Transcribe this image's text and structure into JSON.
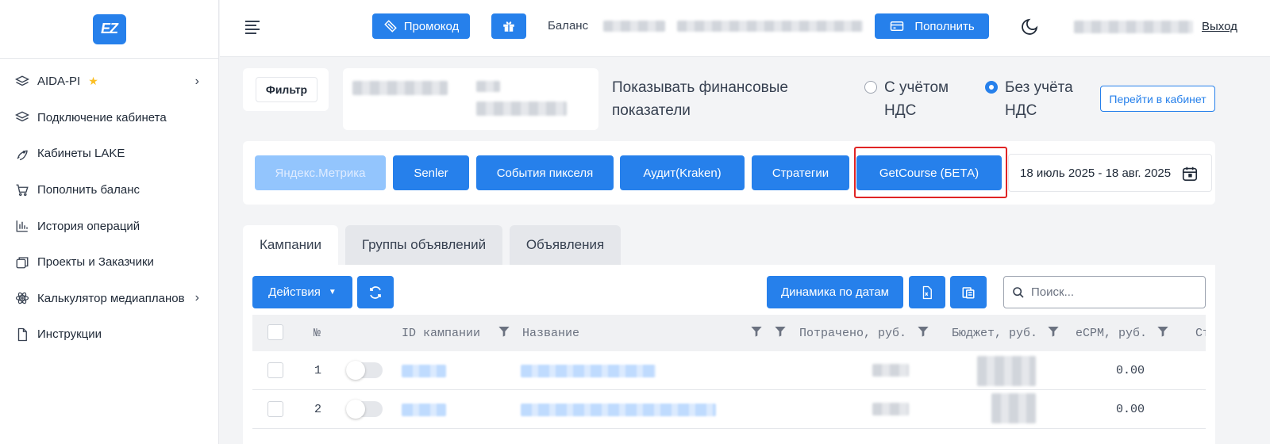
{
  "sidebar": {
    "logo": "EZ",
    "items": [
      {
        "label": "AIDA-PI",
        "icon": "layers-icon",
        "starred": true,
        "has_submenu": true
      },
      {
        "label": "Подключение кабинета",
        "icon": "layers-icon",
        "has_submenu": false
      },
      {
        "label": "Кабинеты LAKE",
        "icon": "rocket-icon",
        "has_submenu": false
      },
      {
        "label": "Пополнить баланс",
        "icon": "cart-icon",
        "has_submenu": false
      },
      {
        "label": "История операций",
        "icon": "bar-chart-icon",
        "has_submenu": false
      },
      {
        "label": "Проекты и Заказчики",
        "icon": "stack-icon",
        "has_submenu": false
      },
      {
        "label": "Калькулятор медиапланов",
        "icon": "atom-icon",
        "has_submenu": true
      },
      {
        "label": "Инструкции",
        "icon": "document-icon",
        "has_submenu": false
      }
    ]
  },
  "header": {
    "promo_label": "Промокод",
    "balance_label": "Баланс",
    "topup_label": "Пополнить",
    "logout_label": "Выход"
  },
  "filters": {
    "filter_label": "Фильтр",
    "fin_label": "Показывать финансовые показатели",
    "vat_with": "С учётом НДС",
    "vat_without": "Без учёта НДС",
    "vat_selected": "vat_without",
    "goto_cabinet": "Перейти в кабинет"
  },
  "integrations": {
    "buttons": [
      {
        "label": "Яндекс.Метрика",
        "disabled": true
      },
      {
        "label": "Senler",
        "disabled": false
      },
      {
        "label": "События пикселя",
        "disabled": false
      },
      {
        "label": "Аудит(Kraken)",
        "disabled": false
      },
      {
        "label": "Стратегии",
        "disabled": false
      },
      {
        "label": "GetCourse (БЕТА)",
        "disabled": false,
        "highlighted": true
      }
    ],
    "date_range": "18 июль 2025 - 18 авг. 2025"
  },
  "tabs": [
    {
      "label": "Кампании",
      "active": true
    },
    {
      "label": "Группы объявлений",
      "active": false
    },
    {
      "label": "Объявления",
      "active": false
    }
  ],
  "toolbar": {
    "actions_label": "Действия",
    "dynamics_label": "Динамика по датам",
    "search_placeholder": "Поиск..."
  },
  "table": {
    "columns": [
      "№",
      "ID кампании",
      "Название",
      "Потрачено, руб.",
      "Бюджет, руб.",
      "eCPM, руб.",
      "Ст"
    ],
    "rows": [
      {
        "num": "1",
        "ecpm": "0.00"
      },
      {
        "num": "2",
        "ecpm": "0.00"
      }
    ]
  },
  "colors": {
    "accent": "#2680eb",
    "highlight": "#e02424"
  }
}
